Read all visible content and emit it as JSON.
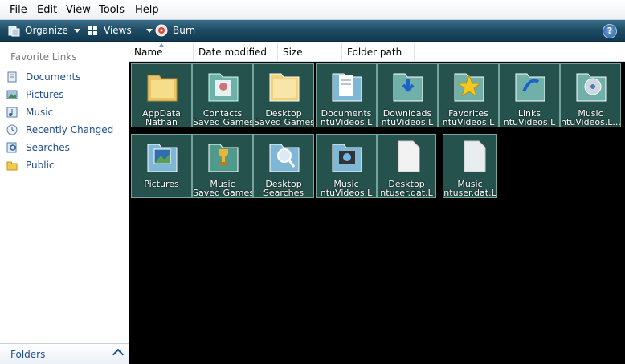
{
  "menu": {
    "file": "File",
    "edit": "Edit",
    "view": "View",
    "tools": "Tools",
    "help": "Help"
  },
  "toolbar": {
    "organize": "Organize",
    "views": "Views",
    "burn": "Burn",
    "help_glyph": "?"
  },
  "nav": {
    "header": "Favorite Links",
    "items": [
      {
        "label": "Documents",
        "icon": "documents-icon"
      },
      {
        "label": "Pictures",
        "icon": "pictures-icon"
      },
      {
        "label": "Music",
        "icon": "music-icon"
      },
      {
        "label": "Recently Changed",
        "icon": "recent-icon"
      },
      {
        "label": "Searches",
        "icon": "searches-icon"
      },
      {
        "label": "Public",
        "icon": "folder-icon"
      }
    ],
    "folders": "Folders"
  },
  "columns": {
    "name": "Name",
    "date": "Date modified",
    "size": "Size",
    "path": "Folder path"
  },
  "tiles": [
    {
      "l1": "AppData",
      "l2": "Nathan"
    },
    {
      "l1": "Contacts",
      "l2": "Saved Games"
    },
    {
      "l1": "Desktop",
      "l2": "Saved Games"
    },
    {
      "l1": "Documents",
      "l2": "ntuVideos.L"
    },
    {
      "l1": "Downloads",
      "l2": "ntuVideos.L"
    },
    {
      "l1": "Favorites",
      "l2": "ntuVideos.L"
    },
    {
      "l1": "Links",
      "l2": "ntuVideos.L"
    },
    {
      "l1": "Music",
      "l2": "ntuVideos.L..."
    },
    {
      "l1": "Pictures",
      "l2": ""
    },
    {
      "l1": "Music",
      "l2": "Saved Games"
    },
    {
      "l1": "Desktop",
      "l2": "Searches"
    },
    {
      "l1": "Music",
      "l2": "ntuVideos.L"
    },
    {
      "l1": "Desktop",
      "l2": "ntuser.dat.L"
    },
    {
      "l1": "Music",
      "l2": "ntuser.dat.L"
    }
  ]
}
